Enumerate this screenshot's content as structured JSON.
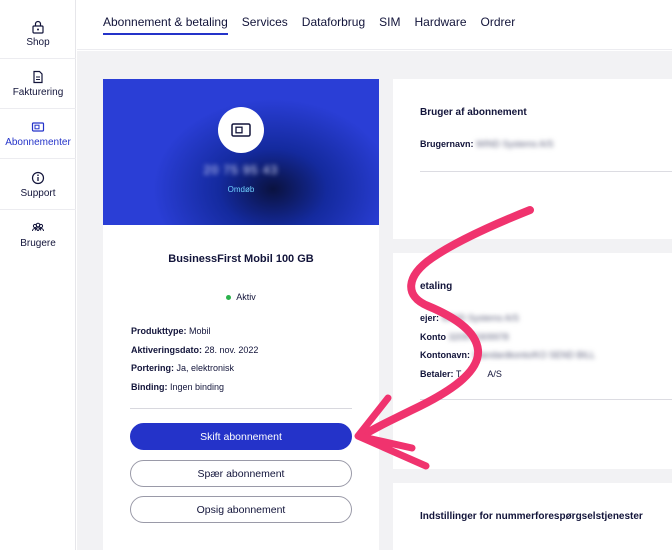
{
  "sidebar": {
    "items": [
      {
        "label": "Shop",
        "icon": "lock-bag-icon"
      },
      {
        "label": "Fakturering",
        "icon": "document-icon"
      },
      {
        "label": "Abonnementer",
        "icon": "sim-card-icon",
        "active": true
      },
      {
        "label": "Support",
        "icon": "info-icon"
      },
      {
        "label": "Brugere",
        "icon": "users-icon"
      }
    ]
  },
  "tabs": [
    {
      "label": "Abonnement & betaling",
      "active": true
    },
    {
      "label": "Services"
    },
    {
      "label": "Dataforbrug"
    },
    {
      "label": "SIM"
    },
    {
      "label": "Hardware"
    },
    {
      "label": "Ordrer"
    }
  ],
  "subscription": {
    "phone_number": "20 75 95 43",
    "rename_link": "Omdøb",
    "plan_name": "BusinessFirst Mobil 100 GB",
    "status": "Aktiv",
    "status_color": "#2bb24c",
    "details": [
      {
        "label": "Produkttype:",
        "value": "Mobil"
      },
      {
        "label": "Aktiveringsdato:",
        "value": "28. nov. 2022"
      },
      {
        "label": "Portering:",
        "value": "Ja, elektronisk"
      },
      {
        "label": "Binding:",
        "value": "Ingen binding"
      }
    ],
    "buttons": {
      "change": "Skift abonnement",
      "block": "Spær abonnement",
      "cancel": "Opsig abonnement"
    }
  },
  "user_card": {
    "title": "Bruger af abonnement",
    "username_label": "Brugernavn:",
    "username_value": "WIND Systems A/S"
  },
  "payment_card": {
    "title": "etaling",
    "rows": [
      {
        "label": "ejer:",
        "value": "WIND Systems A/S"
      },
      {
        "label": "Konto",
        "value": "320970309978"
      },
      {
        "label": "Kontonavn:",
        "value": "Standardkonto/KO SEND BILL"
      },
      {
        "label": "Betaler:",
        "value": "A/S",
        "value_prefix": "T"
      }
    ]
  },
  "settings_card": {
    "title": "Indstillinger for nummerforespørgselstjenester"
  },
  "colors": {
    "accent": "#2433c9",
    "annotation": "#f0336e"
  }
}
